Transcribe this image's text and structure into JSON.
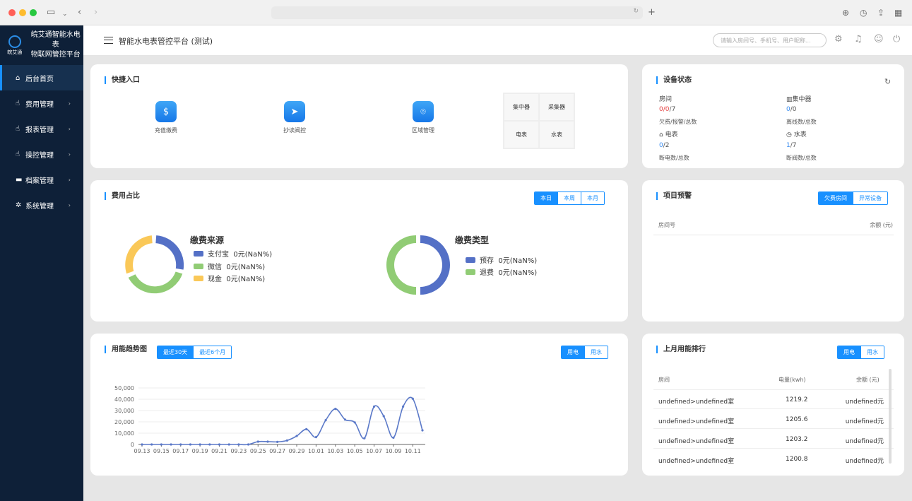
{
  "sidebar": {
    "brand_line1": "皖艾通智能水电表",
    "brand_line2": "物联网管控平台",
    "logo_text": "皖艾通",
    "items": [
      {
        "label": "后台首页",
        "icon": "home-icon",
        "active": true
      },
      {
        "label": "费用管理",
        "icon": "hand-icon"
      },
      {
        "label": "报表管理",
        "icon": "hand-icon"
      },
      {
        "label": "操控管理",
        "icon": "hand-icon"
      },
      {
        "label": "档案管理",
        "icon": "folder-icon"
      },
      {
        "label": "系统管理",
        "icon": "gear-icon"
      }
    ]
  },
  "header": {
    "title": "智能水电表管控平台 (测试)",
    "search_placeholder": "请输入房间号、手机号、用户昵称..."
  },
  "quick_entry": {
    "title": "快捷入口",
    "items": [
      {
        "label": "充值缴费",
        "icon": "money-bag-icon"
      },
      {
        "label": "抄读阀控",
        "icon": "paper-plane-icon"
      },
      {
        "label": "区域管理",
        "icon": "location-pin-icon"
      }
    ],
    "grid": [
      "集中器",
      "采集器",
      "电表",
      "水表"
    ]
  },
  "device_status": {
    "title": "设备状态",
    "room_label": "房间",
    "room_value_a": "0",
    "room_value_b": "0",
    "room_value_c": "7",
    "room_sub": "欠费/报警/总数",
    "concentrator_label": "集中器",
    "concentrator_value_a": "0",
    "concentrator_value_b": "0",
    "concentrator_sub": "离线数/总数",
    "meter_label": "电表",
    "meter_value_a": "0",
    "meter_value_b": "2",
    "meter_sub": "断电数/总数",
    "water_label": "水表",
    "water_value_a": "1",
    "water_value_b": "7",
    "water_sub": "断阀数/总数"
  },
  "fee_ratio": {
    "title": "费用占比",
    "tabs": [
      "本日",
      "本周",
      "本月"
    ],
    "source_title": "缴费来源",
    "source_items": [
      {
        "label": "支付宝",
        "value": "0元(NaN%)",
        "color": "#5470c6"
      },
      {
        "label": "微信",
        "value": "0元(NaN%)",
        "color": "#91cc75"
      },
      {
        "label": "现金",
        "value": "0元(NaN%)",
        "color": "#fac858"
      }
    ],
    "type_title": "缴费类型",
    "type_items": [
      {
        "label": "预存",
        "value": "0元(NaN%)",
        "color": "#5470c6"
      },
      {
        "label": "退费",
        "value": "0元(NaN%)",
        "color": "#91cc75"
      }
    ]
  },
  "project_alert": {
    "title": "项目预警",
    "tabs": [
      "欠费房间",
      "异常设备"
    ],
    "col_room": "房间号",
    "col_balance": "余额 (元)"
  },
  "trend": {
    "title": "用能趋势图",
    "range_tabs": [
      "最近30天",
      "最近6个月"
    ],
    "type_tabs": [
      "用电",
      "用水"
    ]
  },
  "ranking": {
    "title": "上月用能排行",
    "tabs": [
      "用电",
      "用水"
    ],
    "col_room": "房间",
    "col_power": "电量(kwh)",
    "col_balance": "余额 (元)",
    "rows": [
      {
        "room": "undefined>undefined室",
        "power": "1219.2",
        "balance": "undefined元"
      },
      {
        "room": "undefined>undefined室",
        "power": "1205.6",
        "balance": "undefined元"
      },
      {
        "room": "undefined>undefined室",
        "power": "1203.2",
        "balance": "undefined元"
      },
      {
        "room": "undefined>undefined室",
        "power": "1200.8",
        "balance": "undefined元"
      }
    ]
  },
  "chart_data": {
    "type": "line",
    "title": "",
    "xlabel": "",
    "ylabel": "",
    "ylim": [
      0,
      50000
    ],
    "yticks": [
      "0",
      "10,000",
      "20,000",
      "30,000",
      "40,000",
      "50,000"
    ],
    "xticks": [
      "09.13",
      "09.15",
      "09.17",
      "09.19",
      "09.21",
      "09.23",
      "09.25",
      "09.27",
      "09.29",
      "10.01",
      "10.03",
      "10.05",
      "10.07",
      "10.09",
      "10.11"
    ],
    "x": [
      "09.13",
      "09.14",
      "09.15",
      "09.16",
      "09.17",
      "09.18",
      "09.19",
      "09.20",
      "09.21",
      "09.22",
      "09.23",
      "09.24",
      "09.25",
      "09.26",
      "09.27",
      "09.28",
      "09.29",
      "09.30",
      "10.01",
      "10.02",
      "10.03",
      "10.04",
      "10.05",
      "10.06",
      "10.07",
      "10.08",
      "10.09",
      "10.10",
      "10.11",
      "10.12"
    ],
    "series": [
      {
        "values": [
          0,
          0,
          0,
          0,
          0,
          0,
          0,
          0,
          0,
          0,
          0,
          0,
          2500,
          2500,
          2300,
          3500,
          7500,
          13500,
          6500,
          21500,
          31500,
          22000,
          19500,
          5500,
          33500,
          25000,
          6000,
          33500,
          40500,
          12500
        ],
        "color": "#5b79c8"
      }
    ]
  }
}
